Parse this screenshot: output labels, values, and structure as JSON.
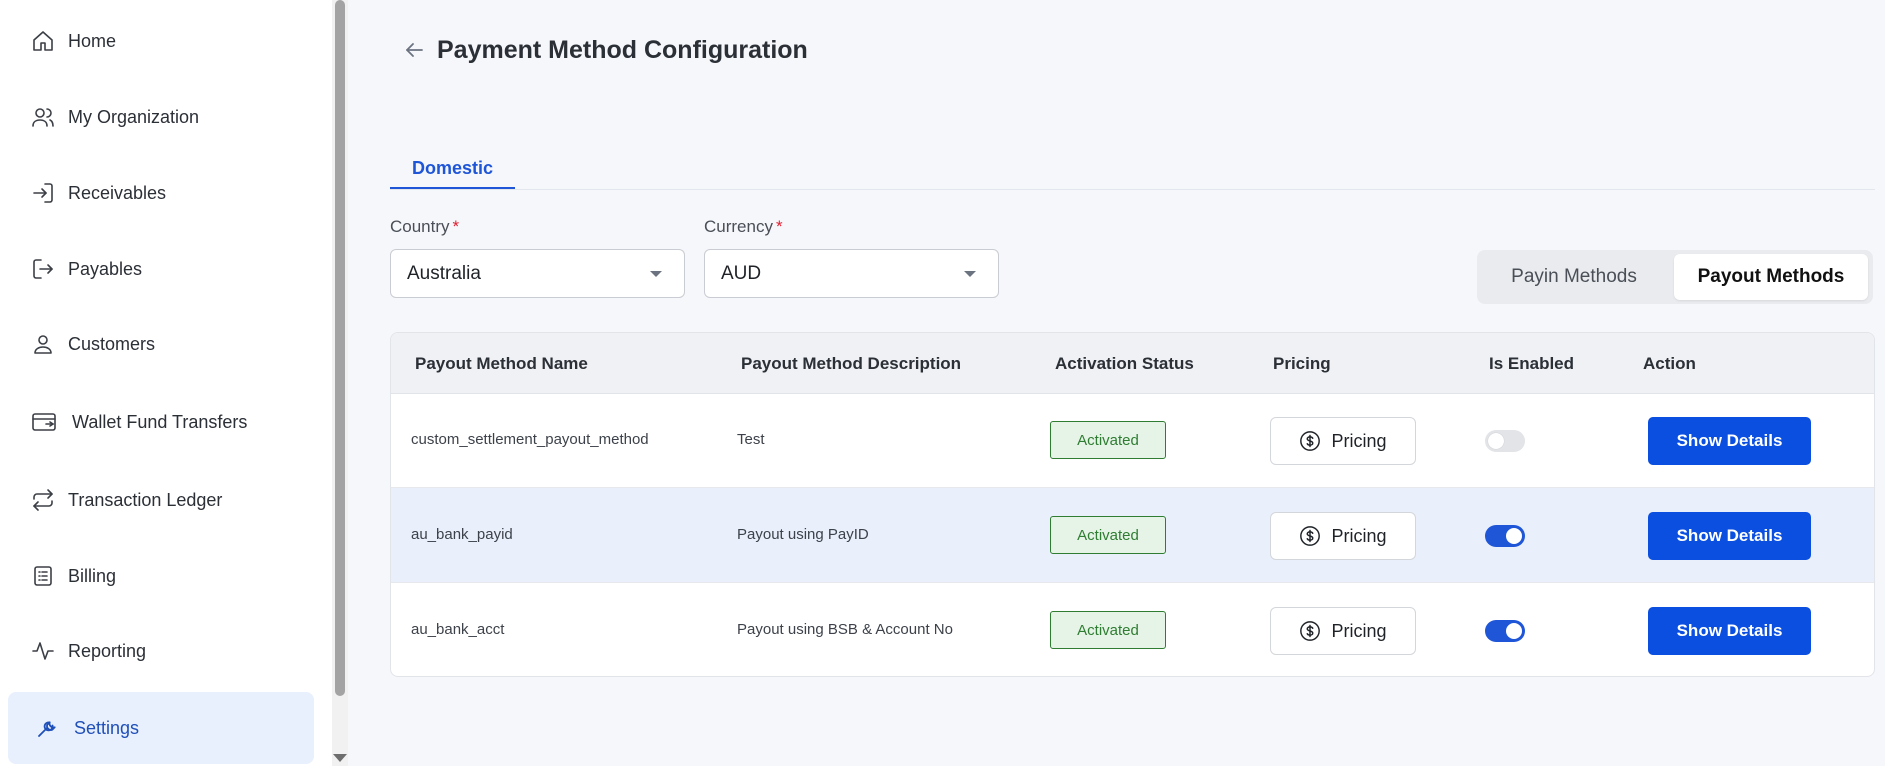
{
  "sidebar": {
    "items": [
      {
        "label": "Home",
        "icon": "home-icon"
      },
      {
        "label": "My Organization",
        "icon": "users-icon"
      },
      {
        "label": "Receivables",
        "icon": "login-arrow-icon"
      },
      {
        "label": "Payables",
        "icon": "logout-arrow-icon"
      },
      {
        "label": "Customers",
        "icon": "user-icon"
      },
      {
        "label": "Wallet Fund Transfers",
        "icon": "wallet-transfer-icon"
      },
      {
        "label": "Transaction Ledger",
        "icon": "repeat-arrows-icon"
      },
      {
        "label": "Billing",
        "icon": "receipt-icon"
      },
      {
        "label": "Reporting",
        "icon": "activity-icon"
      },
      {
        "label": "Settings",
        "icon": "wrench-icon",
        "active": true
      }
    ]
  },
  "header": {
    "title": "Payment Method Configuration"
  },
  "tabs": [
    {
      "label": "Domestic",
      "active": true
    }
  ],
  "filters": {
    "country": {
      "label": "Country",
      "required_mark": "*",
      "value": "Australia"
    },
    "currency": {
      "label": "Currency",
      "required_mark": "*",
      "value": "AUD"
    }
  },
  "method_toggle": {
    "options": [
      "Payin Methods",
      "Payout Methods"
    ],
    "selected": "Payout Methods"
  },
  "table": {
    "columns": [
      "Payout Method Name",
      "Payout Method Description",
      "Activation Status",
      "Pricing",
      "Is Enabled",
      "Action"
    ],
    "rows": [
      {
        "name": "custom_settlement_payout_method",
        "description": "Test",
        "status": "Activated",
        "pricing_label": "Pricing",
        "enabled": false,
        "action_label": "Show Details"
      },
      {
        "name": "au_bank_payid",
        "description": "Payout using PayID",
        "status": "Activated",
        "pricing_label": "Pricing",
        "enabled": true,
        "action_label": "Show Details"
      },
      {
        "name": "au_bank_acct",
        "description": "Payout using BSB & Account No",
        "status": "Activated",
        "pricing_label": "Pricing",
        "enabled": true,
        "action_label": "Show Details"
      }
    ]
  },
  "colors": {
    "accent": "#1f56d8",
    "primary_button": "#0b4fe0",
    "active_nav_bg": "#e8effd",
    "status_green": "#2e7d32",
    "required_red": "#e11d2e"
  }
}
